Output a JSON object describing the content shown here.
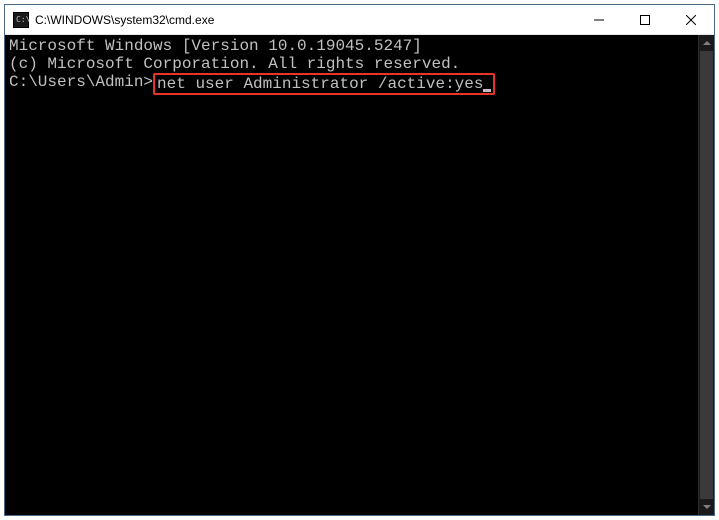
{
  "window": {
    "title": "C:\\WINDOWS\\system32\\cmd.exe"
  },
  "terminal": {
    "banner_line1": "Microsoft Windows [Version 10.0.19045.5247]",
    "banner_line2": "(c) Microsoft Corporation. All rights reserved.",
    "blank": "",
    "prompt": "C:\\Users\\Admin>",
    "command": "net user Administrator /active:yes"
  }
}
